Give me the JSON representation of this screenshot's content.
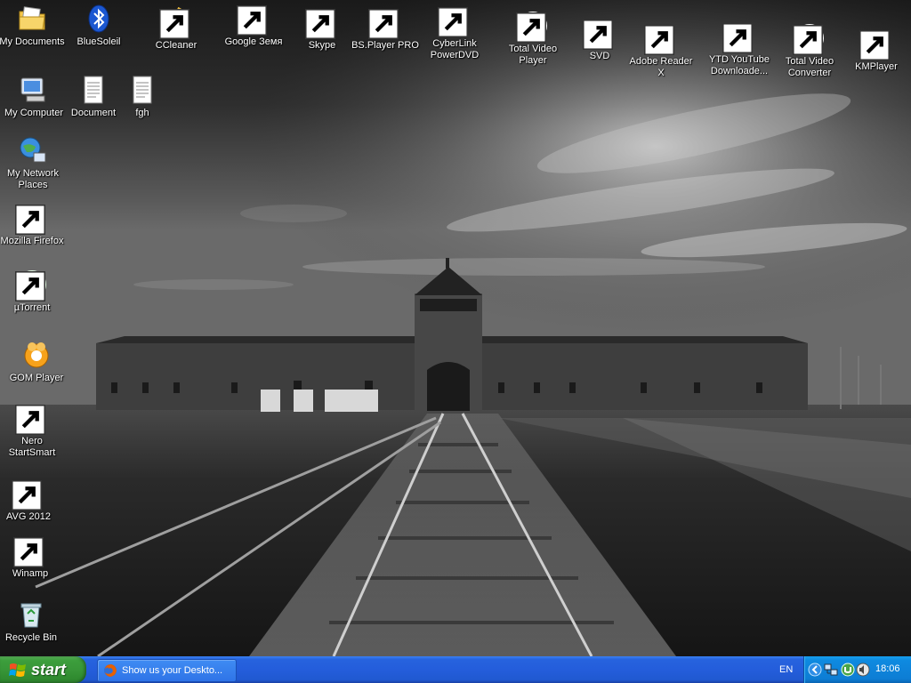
{
  "desktop": {
    "icons": [
      {
        "id": "my-documents",
        "label": "My Documents",
        "icon": "folder-documents-icon",
        "shortcut": false
      },
      {
        "id": "bluesoleil",
        "label": "BlueSoleil",
        "icon": "bluetooth-icon",
        "shortcut": false
      },
      {
        "id": "ccleaner",
        "label": "CCleaner",
        "icon": "ccleaner-icon",
        "shortcut": true
      },
      {
        "id": "google-earth",
        "label": "Google Земя",
        "icon": "google-earth-icon",
        "shortcut": true
      },
      {
        "id": "skype",
        "label": "Skype",
        "icon": "skype-icon",
        "shortcut": true
      },
      {
        "id": "bsplayer",
        "label": "BS.Player PRO",
        "icon": "bsplayer-icon",
        "shortcut": true
      },
      {
        "id": "cyberlink",
        "label": "CyberLink PowerDVD",
        "icon": "powerdvd-icon",
        "shortcut": true
      },
      {
        "id": "total-video-player",
        "label": "Total Video Player",
        "icon": "play-circle-icon",
        "shortcut": true
      },
      {
        "id": "svd",
        "label": "SVD",
        "icon": "svd-icon",
        "shortcut": true
      },
      {
        "id": "adobe-reader",
        "label": "Adobe Reader X",
        "icon": "pdf-icon",
        "shortcut": true
      },
      {
        "id": "ytd",
        "label": "YTD YouTube Downloade...",
        "icon": "download-icon",
        "shortcut": true
      },
      {
        "id": "total-video-converter",
        "label": "Total Video Converter",
        "icon": "converter-icon",
        "shortcut": true
      },
      {
        "id": "kmplayer",
        "label": "KMPlayer",
        "icon": "kmplayer-icon",
        "shortcut": true
      },
      {
        "id": "my-computer",
        "label": "My Computer",
        "icon": "computer-icon",
        "shortcut": false
      },
      {
        "id": "document",
        "label": "Document",
        "icon": "text-file-icon",
        "shortcut": false
      },
      {
        "id": "fgh",
        "label": "fgh",
        "icon": "text-file-icon",
        "shortcut": false
      },
      {
        "id": "my-network-places",
        "label": "My Network Places",
        "icon": "network-icon",
        "shortcut": false
      },
      {
        "id": "firefox",
        "label": "Mozilla Firefox",
        "icon": "firefox-icon",
        "shortcut": true
      },
      {
        "id": "utorrent",
        "label": "µTorrent",
        "icon": "utorrent-icon",
        "shortcut": true
      },
      {
        "id": "gom-player",
        "label": "GOM Player",
        "icon": "gom-icon",
        "shortcut": false
      },
      {
        "id": "nero",
        "label": "Nero StartSmart",
        "icon": "nero-icon",
        "shortcut": true
      },
      {
        "id": "avg",
        "label": "AVG 2012",
        "icon": "avg-icon",
        "shortcut": true
      },
      {
        "id": "winamp",
        "label": "Winamp",
        "icon": "winamp-icon",
        "shortcut": true
      },
      {
        "id": "recycle-bin",
        "label": "Recycle Bin",
        "icon": "recycle-bin-icon",
        "shortcut": false
      }
    ]
  },
  "taskbar": {
    "start_label": "start",
    "tasks": [
      {
        "label": "Show us your Deskto...",
        "icon": "firefox-icon"
      }
    ],
    "language": "EN",
    "clock": "18:06",
    "tray_icons": [
      "chevron-left-icon",
      "network-icon",
      "utorrent-icon",
      "volume-icon"
    ]
  },
  "colors": {
    "taskbar_blue": "#245ddb",
    "start_green": "#389638",
    "tray_blue": "#0d7dd4"
  }
}
